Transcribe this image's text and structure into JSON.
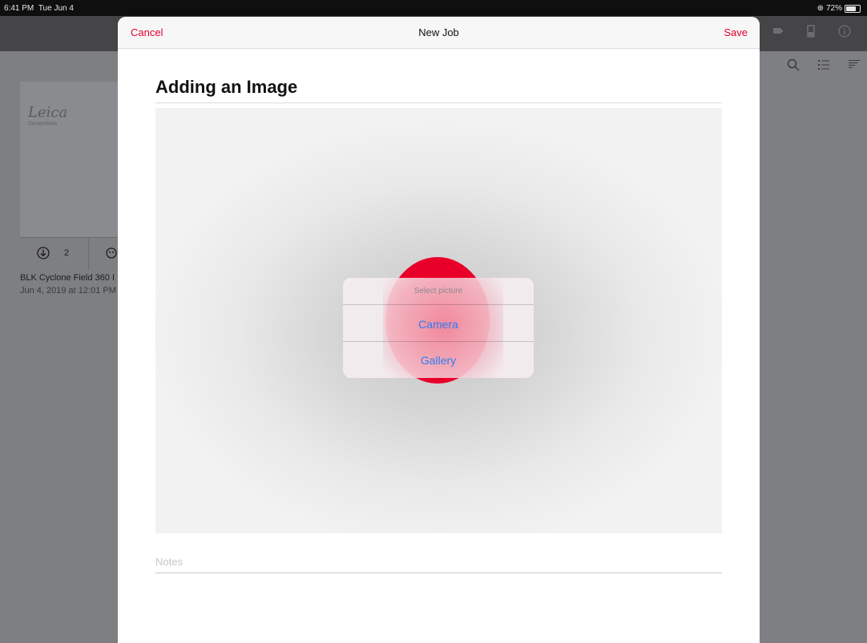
{
  "status_bar": {
    "time": "6:41 PM",
    "date": "Tue Jun 4",
    "battery": "72%",
    "battery_level": 0.72
  },
  "background": {
    "card_logo": "Leica",
    "card_logo_sub": "Geosystems",
    "card_count": "2",
    "card_title": "BLK Cyclone Field 360 I",
    "card_date": "Jun 4, 2019 at 12:01 PM",
    "icons": [
      "camera-icon",
      "device-icon",
      "info-icon",
      "search-icon",
      "list-icon",
      "sort-icon"
    ]
  },
  "sheet": {
    "cancel_label": "Cancel",
    "title": "New Job",
    "save_label": "Save",
    "heading": "Adding an Image",
    "notes_placeholder": "Notes"
  },
  "alert": {
    "title": "Select picture",
    "actions": [
      "Camera",
      "Gallery"
    ]
  },
  "colors": {
    "accent": "#e4022e",
    "action_blue": "#2f7cf6"
  }
}
